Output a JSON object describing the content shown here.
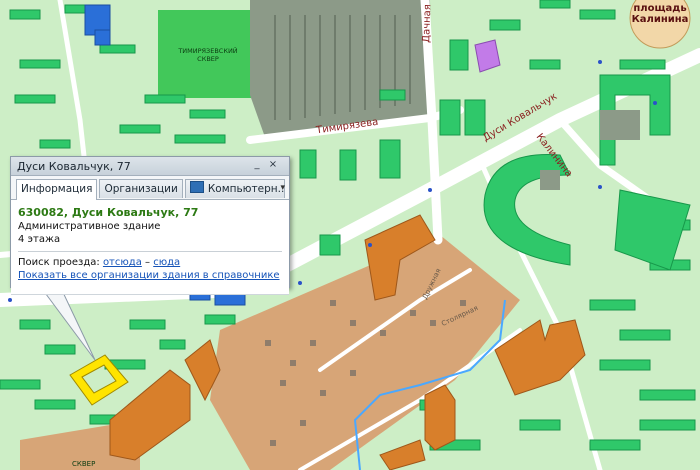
{
  "map": {
    "labels": {
      "square_sq": "ТИМИРЯЗЕВСКИЙ\nСКВЕР",
      "street_timiryazeva": "Тимирязева",
      "street_dachnaya": "Дачная",
      "street_dusi": "Дуси Ковальчук",
      "street_kalinina": "Калинина",
      "street_druzhnaya": "Дружная",
      "street_bottom": "Столярная",
      "square_kalinina": "площадь\nКалинина",
      "bottom_sq": "СКВЕР"
    },
    "colors": {
      "background": "#cdeec6",
      "road": "#ffffff",
      "building": "#2fc86a",
      "industrial": "#d8a878",
      "selected": "#ffe400",
      "blue_building": "#2a6fd8",
      "river": "#4aa8ff"
    }
  },
  "popup": {
    "title": "Дуси Ковальчук, 77",
    "tabs": [
      {
        "label": "Информация",
        "active": true
      },
      {
        "label": "Организации",
        "active": false
      },
      {
        "label": "Компьютерн...",
        "active": false,
        "icon": "computer-icon"
      }
    ],
    "address": "630082, Дуси Ковальчук, 77",
    "building_type": "Административное здание",
    "floors": "4 этажа",
    "route_label": "Поиск проезда:",
    "route_from": "отсюда",
    "route_dash": " – ",
    "route_to": "сюда",
    "show_orgs": "Показать все организации здания в справочнике"
  }
}
